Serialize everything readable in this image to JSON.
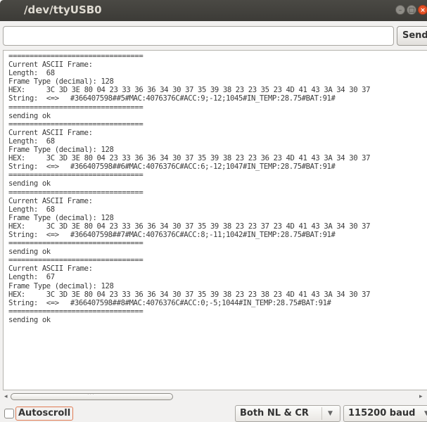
{
  "window": {
    "title": "/dev/ttyUSB0",
    "controls": [
      "minimize-icon",
      "maximize-icon",
      "close-icon"
    ]
  },
  "toolbar": {
    "input_value": "",
    "send_label": "Send"
  },
  "console": {
    "lines": [
      "================================",
      "Current ASCII Frame:",
      "Length:  68",
      "Frame Type (decimal): 128",
      "HEX:     3C 3D 3E 80 04 23 33 36 36 34 30 37 35 39 38 23 23 35 23 4D 41 43 3A 34 30 37",
      "String:  <=>\u0004#366407598##5#MAC:4076376C#ACC:9;-12;1045#IN_TEMP:28.75#BAT:91#",
      "================================",
      "sending ok",
      "================================",
      "Current ASCII Frame:",
      "Length:  68",
      "Frame Type (decimal): 128",
      "HEX:     3C 3D 3E 80 04 23 33 36 36 34 30 37 35 39 38 23 23 36 23 4D 41 43 3A 34 30 37",
      "String:  <=>\u0004#366407598##6#MAC:4076376C#ACC:6;-12;1047#IN_TEMP:28.75#BAT:91#",
      "================================",
      "sending ok",
      "================================",
      "Current ASCII Frame:",
      "Length:  68",
      "Frame Type (decimal): 128",
      "HEX:     3C 3D 3E 80 04 23 33 36 36 34 30 37 35 39 38 23 23 37 23 4D 41 43 3A 34 30 37",
      "String:  <=>\u0004#366407598##7#MAC:4076376C#ACC:8;-11;1042#IN_TEMP:28.75#BAT:91#",
      "================================",
      "sending ok",
      "================================",
      "Current ASCII Frame:",
      "Length:  67",
      "Frame Type (decimal): 128",
      "HEX:     3C 3D 3E 80 04 23 33 36 36 34 30 37 35 39 38 23 23 38 23 4D 41 43 3A 34 30 37",
      "String:  <=>\u0004#366407598##8#MAC:4076376C#ACC:0;-5;1044#IN_TEMP:28.75#BAT:91#",
      "================================",
      "sending ok"
    ]
  },
  "scrollbar": {
    "left_arrow": "◂",
    "right_arrow": "▸",
    "grip": "···"
  },
  "footer": {
    "autoscroll_label": "Autoscroll",
    "autoscroll_checked": false,
    "line_ending": "Both NL & CR",
    "baud": "115200 baud",
    "dropdown_icon": "chevron-down-icon"
  },
  "colors": {
    "titlebar": "#3c3b37",
    "close_button": "#e55125",
    "focus_outline": "#e07b54"
  }
}
